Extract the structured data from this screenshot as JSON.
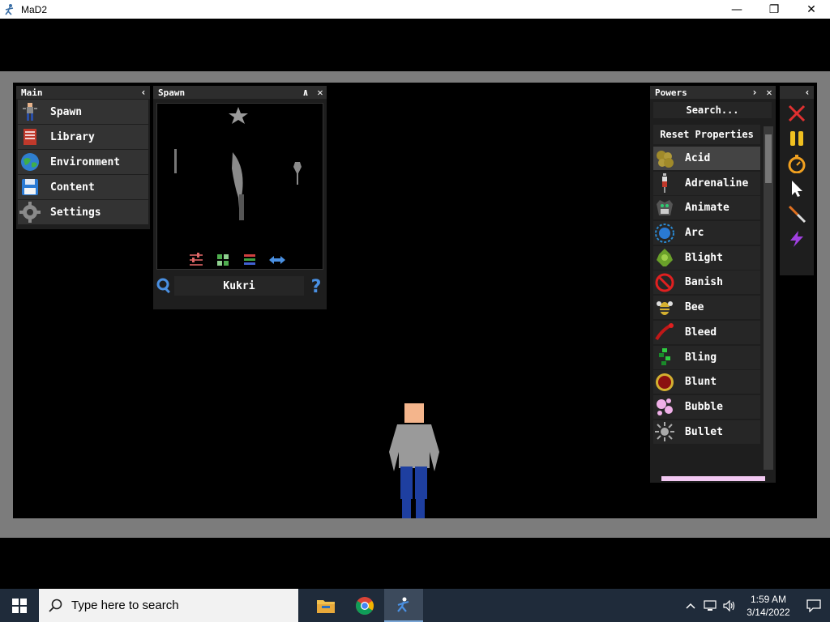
{
  "window": {
    "title": "MaD2",
    "minimize": "—",
    "restore": "❐",
    "close": "✕"
  },
  "main_panel": {
    "title": "Main",
    "collapse": "‹",
    "items": [
      {
        "label": "Spawn",
        "icon": "ragdoll-icon"
      },
      {
        "label": "Library",
        "icon": "book-icon"
      },
      {
        "label": "Environment",
        "icon": "globe-icon"
      },
      {
        "label": "Content",
        "icon": "floppy-disk-icon"
      },
      {
        "label": "Settings",
        "icon": "gear-icon"
      }
    ]
  },
  "spawn_panel": {
    "title": "Spawn",
    "collapse": "∧",
    "close": "✕",
    "selected_item": "Kukri",
    "toolbar": [
      "filter-icon",
      "grid-icon",
      "list-icon",
      "swap-icon"
    ]
  },
  "powers_panel": {
    "title": "Powers",
    "expand": "›",
    "close": "✕",
    "search_placeholder": "Search...",
    "reset_label": "Reset Properties",
    "items": [
      {
        "label": "Acid",
        "icon": "acid-icon",
        "selected": true
      },
      {
        "label": "Adrenaline",
        "icon": "syringe-icon"
      },
      {
        "label": "Animate",
        "icon": "animate-icon"
      },
      {
        "label": "Arc",
        "icon": "arc-icon"
      },
      {
        "label": "Blight",
        "icon": "blight-icon"
      },
      {
        "label": "Banish",
        "icon": "banish-icon"
      },
      {
        "label": "Bee",
        "icon": "bee-icon"
      },
      {
        "label": "Bleed",
        "icon": "bleed-icon"
      },
      {
        "label": "Bling",
        "icon": "bling-icon"
      },
      {
        "label": "Blunt",
        "icon": "blunt-icon"
      },
      {
        "label": "Bubble",
        "icon": "bubble-icon"
      },
      {
        "label": "Bullet",
        "icon": "bullet-icon"
      }
    ]
  },
  "tool_panel": {
    "collapse": "‹",
    "tools": [
      "delete-icon",
      "pause-icon",
      "stopwatch-icon",
      "cursor-icon",
      "knife-icon",
      "lightning-icon"
    ]
  },
  "taskbar": {
    "search_placeholder": "Type here to search",
    "time": "1:59 AM",
    "date": "3/14/2022"
  },
  "colors": {
    "frame": "#7c7c7c",
    "panel": "#1e1e1e",
    "item": "#262626",
    "taskbar": "#1f2b3a"
  }
}
